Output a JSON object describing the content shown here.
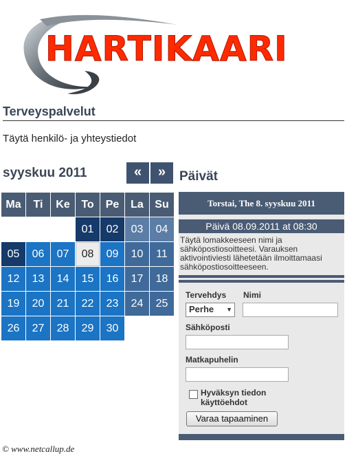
{
  "logo": {
    "text": "HARTIKAARI",
    "accent": "#ff2a00"
  },
  "section_title": "Terveyspalvelut",
  "intro_text": "Täytä henkilö- ja yhteystiedot",
  "calendar": {
    "month_title": "syyskuu 2011",
    "prev_label": "«",
    "next_label": "»",
    "weekdays": [
      "Ma",
      "Ti",
      "Ke",
      "To",
      "Pe",
      "La",
      "Su"
    ],
    "weeks": [
      [
        "",
        "",
        "",
        "01",
        "02",
        "03",
        "04"
      ],
      [
        "05",
        "06",
        "07",
        "08",
        "09",
        "10",
        "11"
      ],
      [
        "12",
        "13",
        "14",
        "15",
        "16",
        "17",
        "18"
      ],
      [
        "19",
        "20",
        "21",
        "22",
        "23",
        "24",
        "25"
      ],
      [
        "26",
        "27",
        "28",
        "29",
        "30",
        "",
        ""
      ]
    ],
    "selected_day": "08"
  },
  "days_panel": {
    "title": "Päivät",
    "date_header": "Torstai, The 8. syyskuu 2011",
    "slot": "Päivä 08.09.2011 at 08:30",
    "instructions": "Täytä lomakkeeseen nimi ja sähköpostiosoitteesi. Varauksen aktivointiviesti lähetetään ilmoittamaasi sähköpostiosoitteeseen."
  },
  "form": {
    "salutation_label": "Tervehdys",
    "salutation_value": "Perhe",
    "name_label": "Nimi",
    "name_value": "",
    "email_label": "Sähköposti",
    "email_value": "",
    "phone_label": "Matkapuhelin",
    "phone_value": "",
    "terms_label": "Hyväksyn tiedon käyttöehdot",
    "terms_checked": false,
    "submit_label": "Varaa tapaaminen"
  },
  "footer": {
    "copyright": "© www.netcallup.de"
  }
}
